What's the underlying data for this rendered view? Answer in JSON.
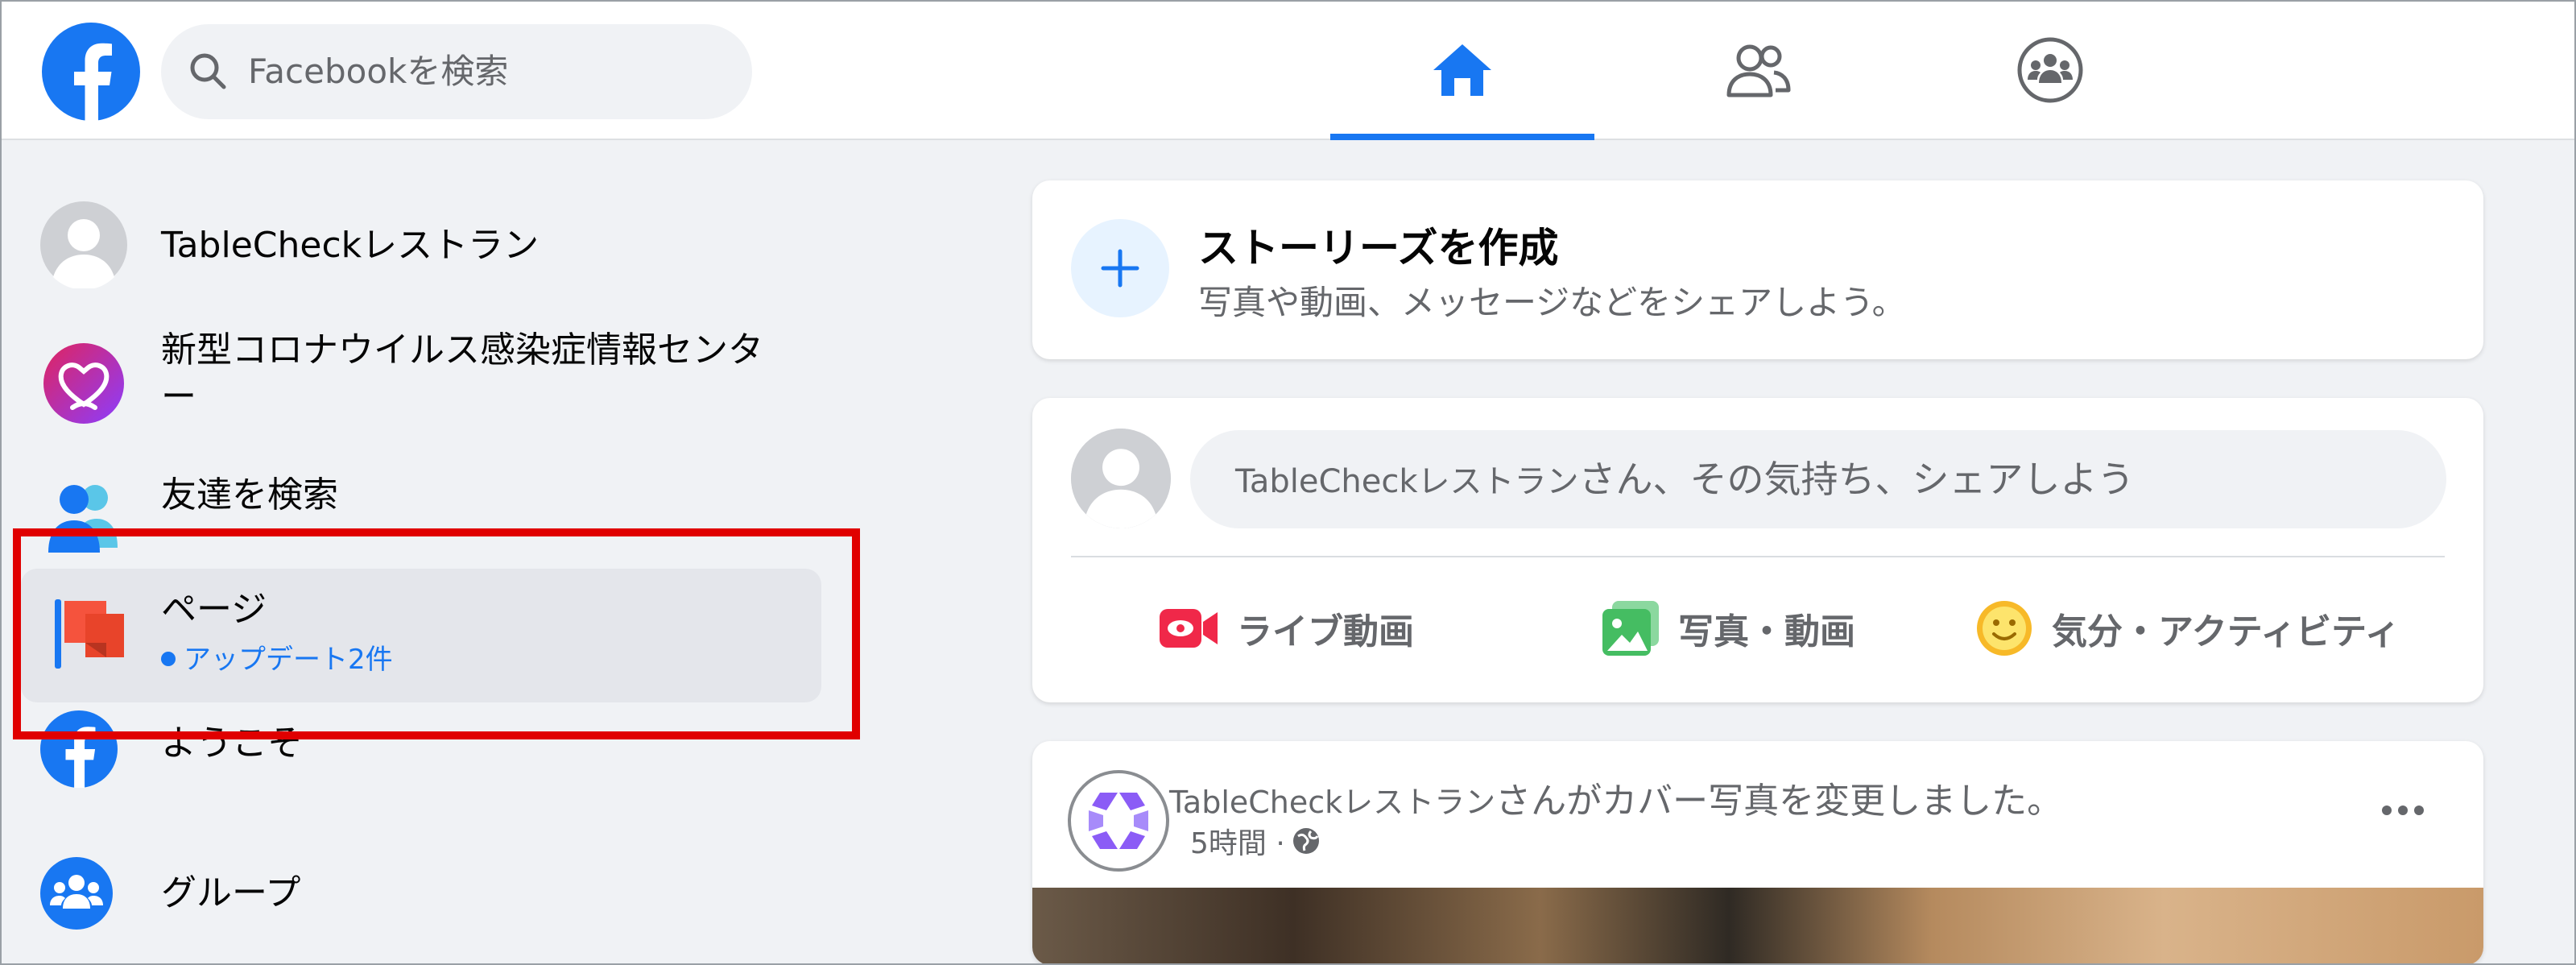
{
  "topbar": {
    "search_placeholder": "Facebookを検索",
    "nav": [
      "home",
      "friends",
      "groups"
    ],
    "accent": "#1877f2"
  },
  "sidebar": {
    "items": [
      {
        "label": "TableCheckレストラン",
        "icon": "profile-avatar-icon"
      },
      {
        "label": "新型コロナウイルス感染症情報センター",
        "icon": "covid-info-heart-icon"
      },
      {
        "label": "友達を検索",
        "icon": "friends-icon"
      },
      {
        "label": "ページ",
        "icon": "flag-icon",
        "sub": "アップデート2件"
      },
      {
        "label": "ようこそ",
        "icon": "facebook-icon"
      },
      {
        "label": "グループ",
        "icon": "groups-icon"
      }
    ],
    "highlight_color": "#e00000"
  },
  "stories": {
    "title": "ストーリーズを作成",
    "subtitle": "写真や動画、メッセージなどをシェアしよう。"
  },
  "composer": {
    "name": "TableCheckレストラン",
    "prompt": "さん、その気持ち、シェアしよう",
    "actions": [
      {
        "label": "ライブ動画",
        "icon": "live-video-icon",
        "color": "#f02849"
      },
      {
        "label": "写真・動画",
        "icon": "photo-icon",
        "color": "#45bd62"
      },
      {
        "label": "気分・アクティビティ",
        "icon": "feeling-icon",
        "color": "#f7b928"
      }
    ]
  },
  "post": {
    "name": "TableCheckレストラン",
    "action_text": "さんがカバー写真を変更しました。",
    "time": "5時間 ·",
    "privacy": "globe-icon"
  }
}
